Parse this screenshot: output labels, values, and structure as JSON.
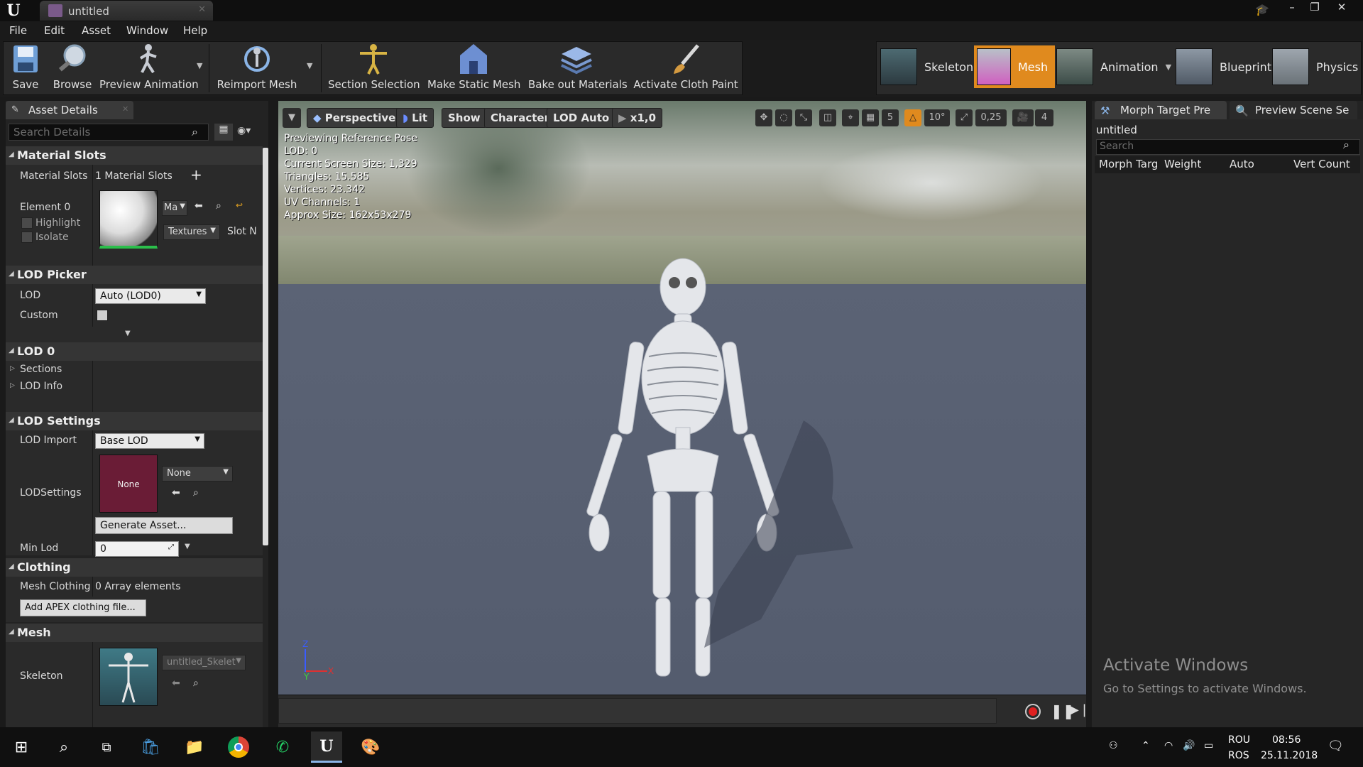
{
  "window": {
    "tab_title": "untitled",
    "controls": [
      "–",
      "❐",
      "✕"
    ]
  },
  "menu": [
    "File",
    "Edit",
    "Asset",
    "Window",
    "Help"
  ],
  "toolbar": {
    "buttons": [
      {
        "label": "Save"
      },
      {
        "label": "Browse"
      },
      {
        "label": "Preview Animation"
      },
      {
        "label": "Reimport Mesh"
      },
      {
        "label": "Section Selection"
      },
      {
        "label": "Make Static Mesh"
      },
      {
        "label": "Bake out Materials"
      },
      {
        "label": "Activate Cloth Paint"
      }
    ],
    "modes": [
      {
        "label": "Skeleton",
        "active": false
      },
      {
        "label": "Mesh",
        "active": true
      },
      {
        "label": "Animation",
        "active": false
      },
      {
        "label": "Blueprint",
        "active": false
      },
      {
        "label": "Physics",
        "active": false
      }
    ]
  },
  "asset_details": {
    "tab": "Asset Details",
    "search_placeholder": "Search Details",
    "material_slots": {
      "header": "Material Slots",
      "label": "Material Slots",
      "value": "1 Material Slots",
      "element_label": "Element 0",
      "highlight_label": "Highlight",
      "isolate_label": "Isolate",
      "material_dd": "Ma",
      "textures_dd": "Textures",
      "slot_name": "Slot N"
    },
    "lod_picker": {
      "header": "LOD Picker",
      "lod_label": "LOD",
      "lod_value": "Auto (LOD0)",
      "custom_label": "Custom"
    },
    "lod0": {
      "header": "LOD 0",
      "sections": "Sections",
      "lod_info": "LOD Info"
    },
    "lod_settings": {
      "header": "LOD Settings",
      "import_label": "LOD Import",
      "import_value": "Base LOD",
      "settings_label": "LODSettings",
      "settings_thumb": "None",
      "settings_value": "None",
      "generate_button": "Generate Asset...",
      "min_lod_label": "Min Lod",
      "min_lod_value": "0"
    },
    "clothing": {
      "header": "Clothing",
      "label": "Mesh Clothing",
      "value": "0 Array elements",
      "add_button": "Add APEX clothing file..."
    },
    "mesh": {
      "header": "Mesh",
      "skeleton_label": "Skeleton",
      "skeleton_value": "untitled_Skelet"
    }
  },
  "viewport": {
    "buttons": [
      "Perspective",
      "Lit",
      "Show",
      "Character",
      "LOD Auto",
      "x1,0"
    ],
    "grid_value": "5",
    "angle_value": "10°",
    "scale_value": "0,25",
    "camera_speed": "4",
    "stats": [
      "Previewing Reference Pose",
      "LOD: 0",
      "Current Screen Size: 1,329",
      "Triangles: 15.585",
      "Vertices: 23.342",
      "UV Channels: 1",
      "Approx Size: 162x53x279"
    ],
    "axes": {
      "z": "Z",
      "y": "Y",
      "x": "X"
    }
  },
  "right_panel": {
    "tabs": [
      "Morph Target Pre",
      "Preview Scene Se"
    ],
    "title": "untitled",
    "search_placeholder": "Search",
    "columns": [
      "Morph Targ",
      "Weight",
      "Auto",
      "Vert Count"
    ],
    "watermark_title": "Activate Windows",
    "watermark_sub": "Go to Settings to activate Windows."
  },
  "taskbar": {
    "lang_top": "ROU",
    "lang_bottom": "ROS",
    "time": "08:56",
    "date": "25.11.2018"
  },
  "colors": {
    "accent": "#e08a1e",
    "mesh_active": "#e08a1e",
    "lod_thumb": "#6a1c36"
  }
}
